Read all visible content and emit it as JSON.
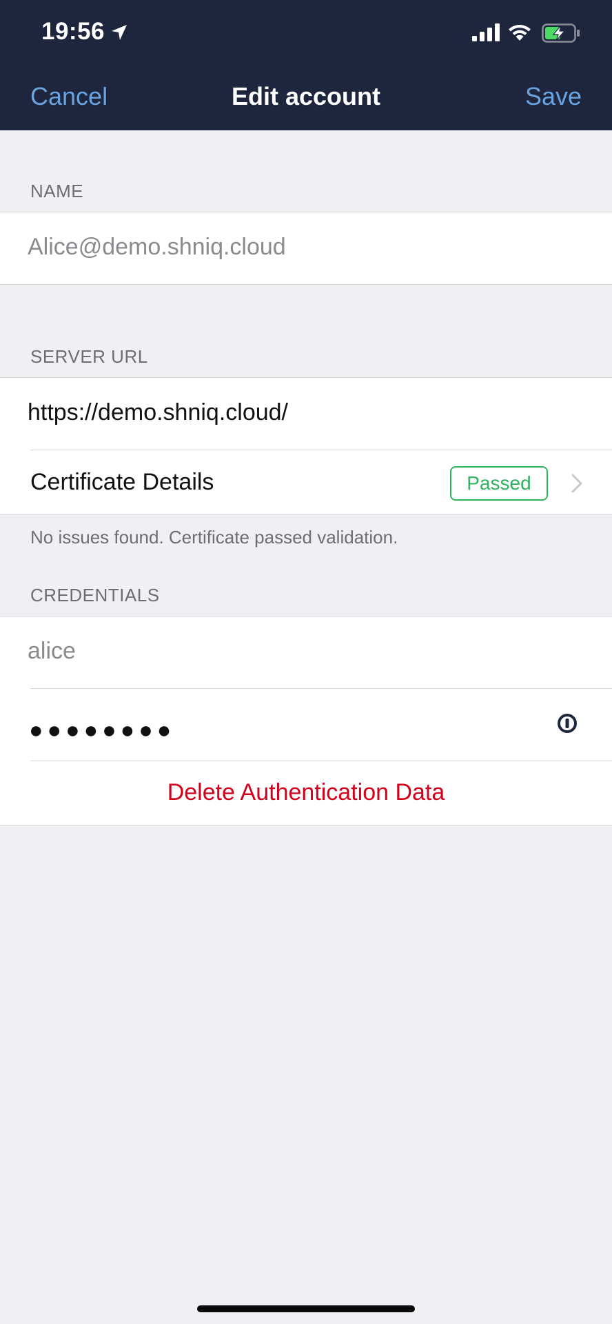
{
  "status_bar": {
    "time": "19:56",
    "icons": [
      "location-arrow-icon",
      "cell-signal-icon",
      "wifi-icon",
      "battery-charging-icon"
    ]
  },
  "nav": {
    "cancel_label": "Cancel",
    "title": "Edit account",
    "save_label": "Save"
  },
  "name_section": {
    "header": "NAME",
    "name_value": "Alice@demo.shniq.cloud"
  },
  "server_section": {
    "header": "SERVER URL",
    "url_value": "https://demo.shniq.cloud/",
    "certificate_label": "Certificate Details",
    "certificate_status": "Passed",
    "footer": "No issues found. Certificate passed validation."
  },
  "credentials_section": {
    "header": "CREDENTIALS",
    "username_value": "alice",
    "password_value": "●●●●●●●●",
    "delete_label": "Delete Authentication Data"
  },
  "colors": {
    "nav_background": "#1e263d",
    "accent": "#6aa4e0",
    "passed_green": "#2db35a",
    "destructive_red": "#d0021b",
    "background": "#efeff4"
  }
}
